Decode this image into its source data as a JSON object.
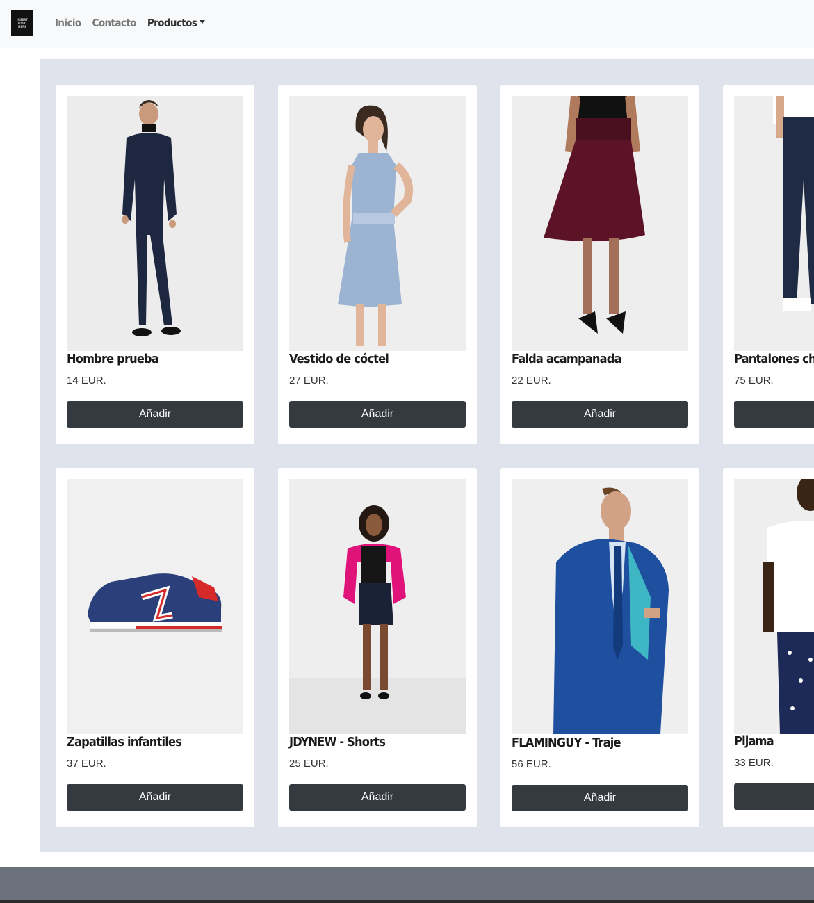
{
  "brand": {
    "logo_text": "INSERT LOGO HERE"
  },
  "nav": {
    "links": [
      {
        "label": "Inicio"
      },
      {
        "label": "Contacto"
      },
      {
        "label": "Productos"
      }
    ]
  },
  "products": [
    {
      "name": "Hombre prueba",
      "price": "14 EUR.",
      "button": "Añadir",
      "image": "man-navy-suit-image"
    },
    {
      "name": "Vestido de cóctel",
      "price": "27 EUR.",
      "button": "Añadir",
      "image": "blue-dress-image"
    },
    {
      "name": "Falda acampanada",
      "price": "22 EUR.",
      "button": "Añadir",
      "image": "burgundy-skirt-image"
    },
    {
      "name": "Pantalones ch",
      "price": "75 EUR.",
      "button": "A",
      "image": "navy-trousers-image"
    },
    {
      "name": "Zapatillas infantiles",
      "price": "37 EUR.",
      "button": "Añadir",
      "image": "navy-sneaker-image"
    },
    {
      "name": "JDYNEW - Shorts",
      "price": "25 EUR.",
      "button": "Añadir",
      "image": "shorts-outfit-image"
    },
    {
      "name": "FLAMINGUY - Traje",
      "price": "56 EUR.",
      "button": "Añadir",
      "image": "blue-suit-image"
    },
    {
      "name": "Pijama",
      "price": "33 EUR.",
      "button": "A",
      "image": "pajama-image"
    }
  ],
  "colors": {
    "navbar_bg": "#f8f9fa",
    "main_bg": "#e0e2ec",
    "button_bg": "#343a40",
    "footer_bg": "#6c727c"
  }
}
